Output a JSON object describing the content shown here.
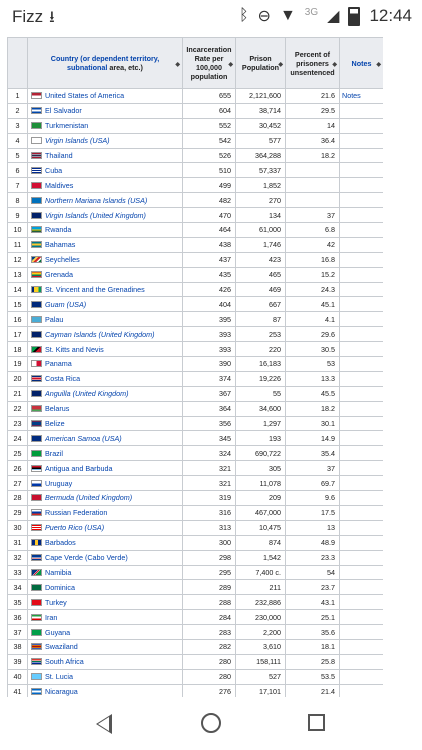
{
  "statusbar": {
    "carrier": "Fizz",
    "download_icon": "download-icon",
    "bluetooth_icon": "bluetooth-icon",
    "dnd_icon": "do-not-disturb-icon",
    "network": "3G",
    "time": "12:44"
  },
  "table": {
    "headers": {
      "rank": "",
      "country_link1": "Country (or dependent territory,",
      "country_link2": "subnational",
      "country_rest": " area, etc.)",
      "rate": "Incarceration Rate per 100,000 population",
      "prison": "Prison Population",
      "percent": "Percent of prisoners unsentenced",
      "notes": "Notes"
    },
    "rows": [
      {
        "rank": "1",
        "name": "United States of America",
        "italic": false,
        "rate": "655",
        "pop": "2,121,600",
        "pct": "21.6",
        "notes": "Notes",
        "flag": "us"
      },
      {
        "rank": "2",
        "name": "El Salvador",
        "italic": false,
        "rate": "604",
        "pop": "38,714",
        "pct": "29.5",
        "notes": "",
        "flag": "sv"
      },
      {
        "rank": "3",
        "name": "Turkmenistan",
        "italic": false,
        "rate": "552",
        "pop": "30,452",
        "pct": "14",
        "notes": "",
        "flag": "tm"
      },
      {
        "rank": "4",
        "name": "Virgin Islands (USA)",
        "italic": true,
        "rate": "542",
        "pop": "577",
        "pct": "36.4",
        "notes": "",
        "flag": "vi"
      },
      {
        "rank": "5",
        "name": "Thailand",
        "italic": false,
        "rate": "526",
        "pop": "364,288",
        "pct": "18.2",
        "notes": "",
        "flag": "th"
      },
      {
        "rank": "6",
        "name": "Cuba",
        "italic": false,
        "rate": "510",
        "pop": "57,337",
        "pct": "",
        "notes": "",
        "flag": "cu"
      },
      {
        "rank": "7",
        "name": "Maldives",
        "italic": false,
        "rate": "499",
        "pop": "1,852",
        "pct": "",
        "notes": "",
        "flag": "mv"
      },
      {
        "rank": "8",
        "name": "Northern Mariana Islands (USA)",
        "italic": true,
        "rate": "482",
        "pop": "270",
        "pct": "",
        "notes": "",
        "flag": "mp"
      },
      {
        "rank": "9",
        "name": "Virgin Islands (United Kingdom)",
        "italic": true,
        "rate": "470",
        "pop": "134",
        "pct": "37",
        "notes": "",
        "flag": "vg"
      },
      {
        "rank": "10",
        "name": "Rwanda",
        "italic": false,
        "rate": "464",
        "pop": "61,000",
        "pct": "6.8",
        "notes": "",
        "flag": "rw"
      },
      {
        "rank": "11",
        "name": "Bahamas",
        "italic": false,
        "rate": "438",
        "pop": "1,746",
        "pct": "42",
        "notes": "",
        "flag": "bs"
      },
      {
        "rank": "12",
        "name": "Seychelles",
        "italic": false,
        "rate": "437",
        "pop": "423",
        "pct": "16.8",
        "notes": "",
        "flag": "sc"
      },
      {
        "rank": "13",
        "name": "Grenada",
        "italic": false,
        "rate": "435",
        "pop": "465",
        "pct": "15.2",
        "notes": "",
        "flag": "gd"
      },
      {
        "rank": "14",
        "name": "St. Vincent and the Grenadines",
        "italic": false,
        "rate": "426",
        "pop": "469",
        "pct": "24.3",
        "notes": "",
        "flag": "vc"
      },
      {
        "rank": "15",
        "name": "Guam (USA)",
        "italic": true,
        "rate": "404",
        "pop": "667",
        "pct": "45.1",
        "notes": "",
        "flag": "gu"
      },
      {
        "rank": "16",
        "name": "Palau",
        "italic": false,
        "rate": "395",
        "pop": "87",
        "pct": "4.1",
        "notes": "",
        "flag": "pw"
      },
      {
        "rank": "17",
        "name": "Cayman Islands (United Kingdom)",
        "italic": true,
        "rate": "393",
        "pop": "253",
        "pct": "29.6",
        "notes": "",
        "flag": "ky"
      },
      {
        "rank": "18",
        "name": "St. Kitts and Nevis",
        "italic": false,
        "rate": "393",
        "pop": "220",
        "pct": "30.5",
        "notes": "",
        "flag": "kn"
      },
      {
        "rank": "19",
        "name": "Panama",
        "italic": false,
        "rate": "390",
        "pop": "16,183",
        "pct": "53",
        "notes": "",
        "flag": "pa"
      },
      {
        "rank": "20",
        "name": "Costa Rica",
        "italic": false,
        "rate": "374",
        "pop": "19,226",
        "pct": "13.3",
        "notes": "",
        "flag": "cr"
      },
      {
        "rank": "21",
        "name": "Anguilla (United Kingdom)",
        "italic": true,
        "rate": "367",
        "pop": "55",
        "pct": "45.5",
        "notes": "",
        "flag": "ai"
      },
      {
        "rank": "22",
        "name": "Belarus",
        "italic": false,
        "rate": "364",
        "pop": "34,600",
        "pct": "18.2",
        "notes": "",
        "flag": "by"
      },
      {
        "rank": "23",
        "name": "Belize",
        "italic": false,
        "rate": "356",
        "pop": "1,297",
        "pct": "30.1",
        "notes": "",
        "flag": "bz"
      },
      {
        "rank": "24",
        "name": "American Samoa (USA)",
        "italic": true,
        "rate": "345",
        "pop": "193",
        "pct": "14.9",
        "notes": "",
        "flag": "as"
      },
      {
        "rank": "25",
        "name": "Brazil",
        "italic": false,
        "rate": "324",
        "pop": "690,722",
        "pct": "35.4",
        "notes": "",
        "flag": "br"
      },
      {
        "rank": "26",
        "name": "Antigua and Barbuda",
        "italic": false,
        "rate": "321",
        "pop": "305",
        "pct": "37",
        "notes": "",
        "flag": "ag"
      },
      {
        "rank": "27",
        "name": "Uruguay",
        "italic": false,
        "rate": "321",
        "pop": "11,078",
        "pct": "69.7",
        "notes": "",
        "flag": "uy"
      },
      {
        "rank": "28",
        "name": "Bermuda (United Kingdom)",
        "italic": true,
        "rate": "319",
        "pop": "209",
        "pct": "9.6",
        "notes": "",
        "flag": "bm"
      },
      {
        "rank": "29",
        "name": "Russian Federation",
        "italic": false,
        "rate": "316",
        "pop": "467,000",
        "pct": "17.5",
        "notes": "",
        "flag": "ru"
      },
      {
        "rank": "30",
        "name": "Puerto Rico (USA)",
        "italic": true,
        "rate": "313",
        "pop": "10,475",
        "pct": "13",
        "notes": "",
        "flag": "pr"
      },
      {
        "rank": "31",
        "name": "Barbados",
        "italic": false,
        "rate": "300",
        "pop": "874",
        "pct": "48.9",
        "notes": "",
        "flag": "bb"
      },
      {
        "rank": "32",
        "name": "Cape Verde (Cabo Verde)",
        "italic": false,
        "rate": "298",
        "pop": "1,542",
        "pct": "23.3",
        "notes": "",
        "flag": "cv"
      },
      {
        "rank": "33",
        "name": "Namibia",
        "italic": false,
        "rate": "295",
        "pop": "7,400 c.",
        "pct": "54",
        "notes": "",
        "flag": "na"
      },
      {
        "rank": "34",
        "name": "Dominica",
        "italic": false,
        "rate": "289",
        "pop": "211",
        "pct": "23.7",
        "notes": "",
        "flag": "dm"
      },
      {
        "rank": "35",
        "name": "Turkey",
        "italic": false,
        "rate": "288",
        "pop": "232,886",
        "pct": "43.1",
        "notes": "",
        "flag": "tr"
      },
      {
        "rank": "36",
        "name": "Iran",
        "italic": false,
        "rate": "284",
        "pop": "230,000",
        "pct": "25.1",
        "notes": "",
        "flag": "ir"
      },
      {
        "rank": "37",
        "name": "Guyana",
        "italic": false,
        "rate": "283",
        "pop": "2,200",
        "pct": "35.6",
        "notes": "",
        "flag": "gy"
      },
      {
        "rank": "38",
        "name": "Swaziland",
        "italic": false,
        "rate": "282",
        "pop": "3,610",
        "pct": "18.1",
        "notes": "",
        "flag": "sz"
      },
      {
        "rank": "39",
        "name": "South Africa",
        "italic": false,
        "rate": "280",
        "pop": "158,111",
        "pct": "25.8",
        "notes": "",
        "flag": "za"
      },
      {
        "rank": "40",
        "name": "St. Lucia",
        "italic": false,
        "rate": "280",
        "pop": "527",
        "pct": "53.5",
        "notes": "",
        "flag": "lc"
      },
      {
        "rank": "41",
        "name": "Nicaragua",
        "italic": false,
        "rate": "276",
        "pop": "17,101",
        "pct": "21.4",
        "notes": "",
        "flag": "ni"
      }
    ]
  },
  "flag_colors": {
    "us": "linear-gradient(#b22234 0 50%,#fff 50%)",
    "sv": "linear-gradient(#0047ab 0 33%,#fff 33% 66%,#0047ab 66%)",
    "tm": "linear-gradient(90deg,#1f8f3a 0 100%)",
    "vi": "linear-gradient(#fff 0 100%)",
    "th": "linear-gradient(#a51931 0 17%,#fff 17% 33%,#2d2a4a 33% 67%,#fff 67% 83%,#a51931 83%)",
    "cu": "linear-gradient(#002a8f 0 20%,#fff 20% 40%,#002a8f 40% 60%,#fff 60% 80%,#002a8f 80%)",
    "mv": "linear-gradient(#d21034 0 100%)",
    "mp": "linear-gradient(#0071bc 0 100%)",
    "vg": "linear-gradient(#012169 0 100%)",
    "rw": "linear-gradient(#00a1de 0 50%,#fad201 50% 75%,#20603d 75%)",
    "bs": "linear-gradient(#00778b 0 33%,#ffc72c 33% 66%,#00778b 66%)",
    "sc": "linear-gradient(135deg,#003f87 0 25%,#fcd856 25% 45%,#d62828 45% 65%,#fff 65% 80%,#007a3d 80%)",
    "gd": "linear-gradient(#ce1126 0 15%,#fcd116 15% 50%,#007a5e 50% 85%,#ce1126 85%)",
    "vc": "linear-gradient(90deg,#002674 0 25%,#fcd022 25% 75%,#009e60 75%)",
    "gu": "linear-gradient(#00297b 0 100%)",
    "pw": "linear-gradient(#4aadd6 0 100%)",
    "ky": "linear-gradient(#012169 0 100%)",
    "kn": "linear-gradient(135deg,#009e49 0 40%,#000 40% 60%,#ce1126 60%)",
    "pa": "linear-gradient(90deg,#fff 0 50%,#d21034 50%)",
    "cr": "linear-gradient(#002b7f 0 17%,#fff 17% 33%,#ce1126 33% 67%,#fff 67% 83%,#002b7f 83%)",
    "ai": "linear-gradient(#012169 0 100%)",
    "by": "linear-gradient(#c8313e 0 67%,#4aa657 67%)",
    "bz": "linear-gradient(#ce1126 0 12%,#003f87 12% 88%,#ce1126 88%)",
    "as": "linear-gradient(#002b7f 0 100%)",
    "br": "linear-gradient(#009c3b 0 100%)",
    "ag": "linear-gradient(#ce1126 0 30%,#000 30% 60%,#0072c6 60% 75%,#fff 75%)",
    "uy": "linear-gradient(#fff 0 50%,#0038a8 50%)",
    "bm": "linear-gradient(#c8102e 0 100%)",
    "ru": "linear-gradient(#fff 0 33%,#0039a6 33% 66%,#d52b1e 66%)",
    "pr": "linear-gradient(#ed0000 0 20%,#fff 20% 40%,#ed0000 40% 60%,#fff 60% 80%,#ed0000 80%)",
    "bb": "linear-gradient(90deg,#00267f 0 33%,#ffc726 33% 66%,#00267f 66%)",
    "cv": "linear-gradient(#003893 0 55%,#fff 55% 65%,#cf2027 65% 75%,#fff 75% 85%,#003893 85%)",
    "na": "linear-gradient(135deg,#003580 0 40%,#fff 40% 45%,#d21034 45% 55%,#fff 55% 60%,#009543 60%)",
    "dm": "linear-gradient(#006b3f 0 100%)",
    "tr": "linear-gradient(#e30a17 0 100%)",
    "ir": "linear-gradient(#239f40 0 33%,#fff 33% 66%,#da0000 66%)",
    "gy": "linear-gradient(#009e49 0 100%)",
    "sz": "linear-gradient(#3e5eb9 0 20%,#ffd900 20% 30%,#b10c0c 30% 70%,#ffd900 70% 80%,#3e5eb9 80%)",
    "za": "linear-gradient(#de3831 0 33%,#fff 33% 40%,#007a4d 40% 60%,#fff 60% 67%,#002395 67%)",
    "lc": "linear-gradient(#66ccff 0 100%)",
    "ni": "linear-gradient(#0067c6 0 33%,#fff 33% 66%,#0067c6 66%)"
  },
  "navbar": {
    "back": "back-icon",
    "home": "home-icon",
    "recent": "recent-apps-icon"
  }
}
